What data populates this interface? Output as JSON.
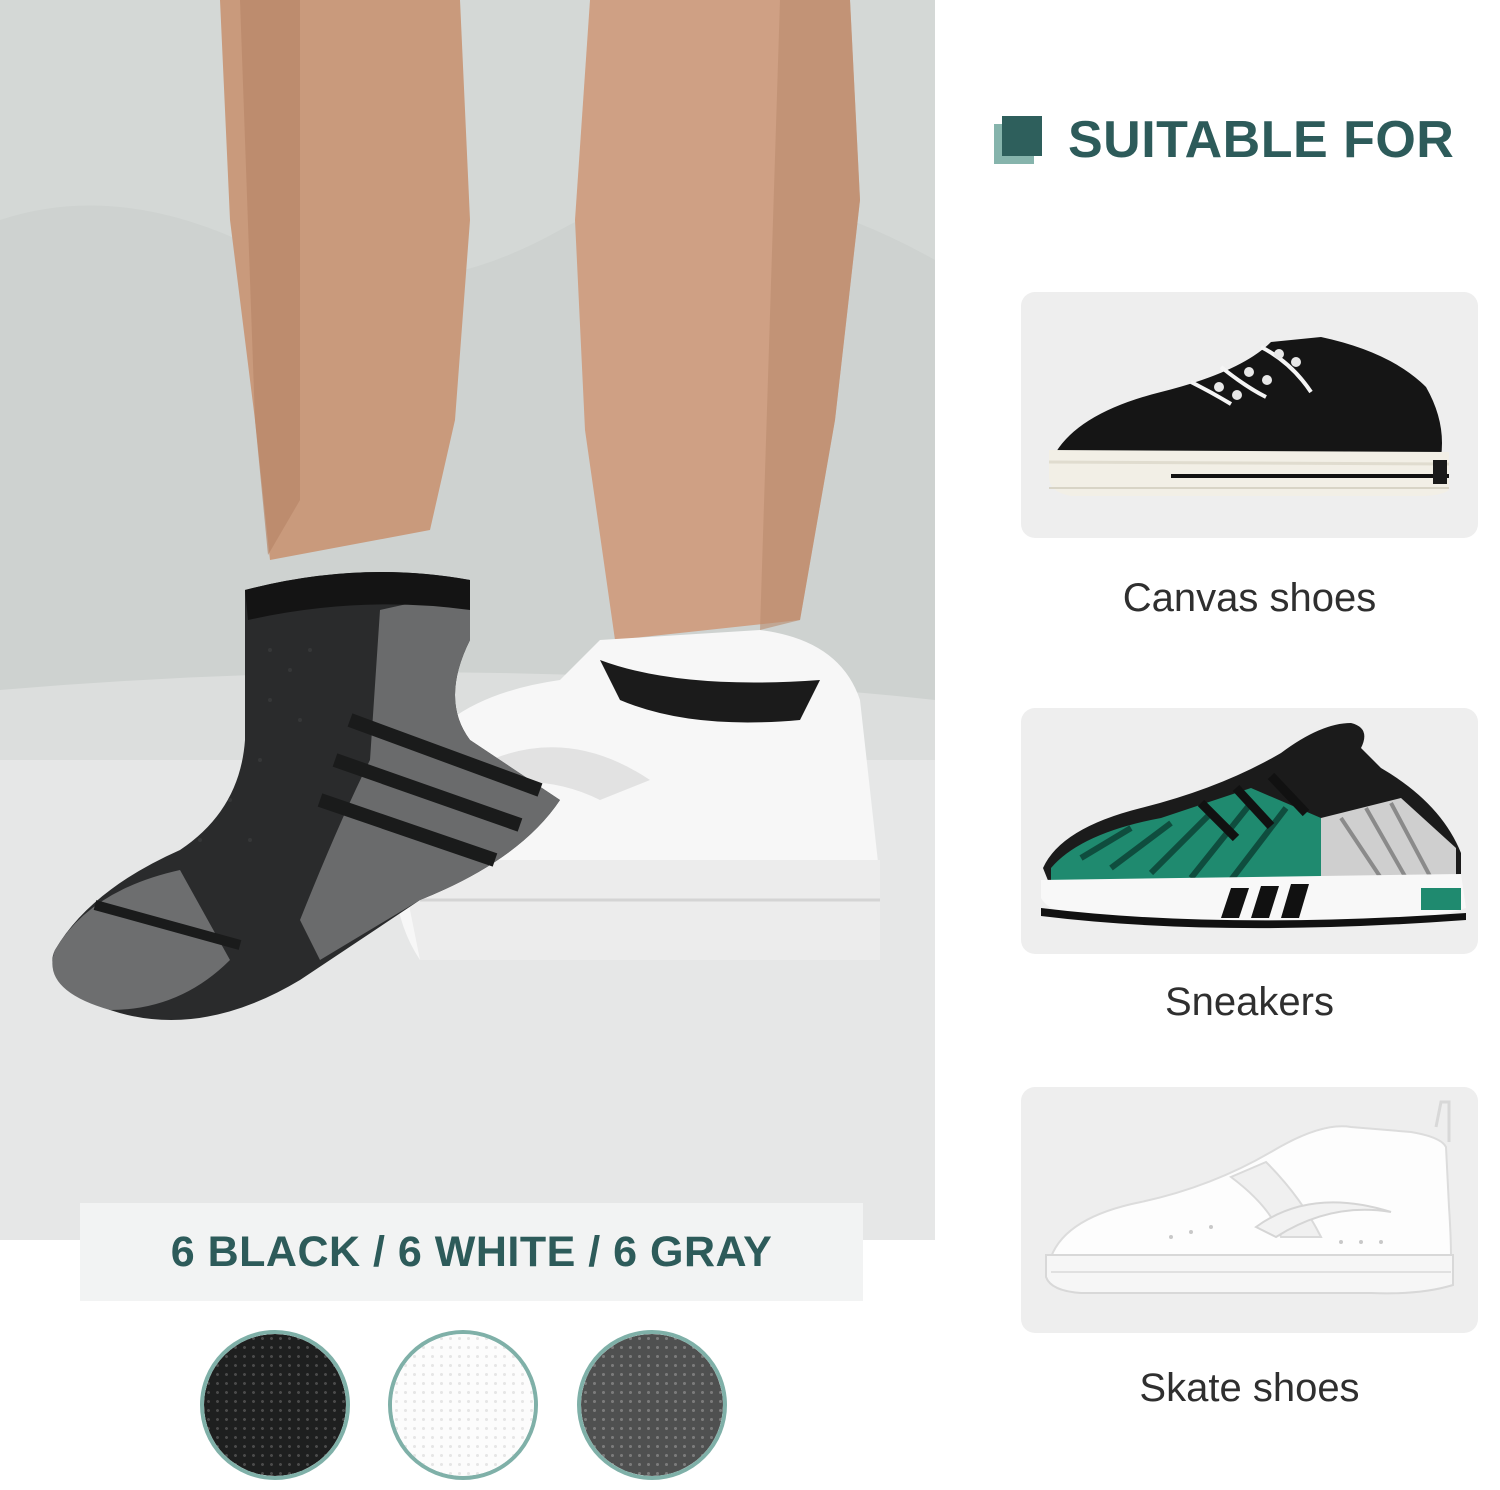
{
  "header": {
    "title": "SUITABLE FOR"
  },
  "colors_banner": {
    "text": "6 BLACK / 6 WHITE / 6 GRAY"
  },
  "swatches": [
    {
      "name": "black",
      "color": "#1e1f1f"
    },
    {
      "name": "white",
      "color": "#fcfcfc"
    },
    {
      "name": "gray",
      "color": "#4f5050"
    }
  ],
  "shoes": [
    {
      "label": "Canvas shoes",
      "icon": "canvas-shoe-image"
    },
    {
      "label": "Sneakers",
      "icon": "sneaker-image"
    },
    {
      "label": "Skate shoes",
      "icon": "skate-shoe-image"
    }
  ],
  "theme": {
    "accent_dark": "#2d5b5a",
    "accent_light": "#86b4ac",
    "card_background": "#eeeeee"
  }
}
